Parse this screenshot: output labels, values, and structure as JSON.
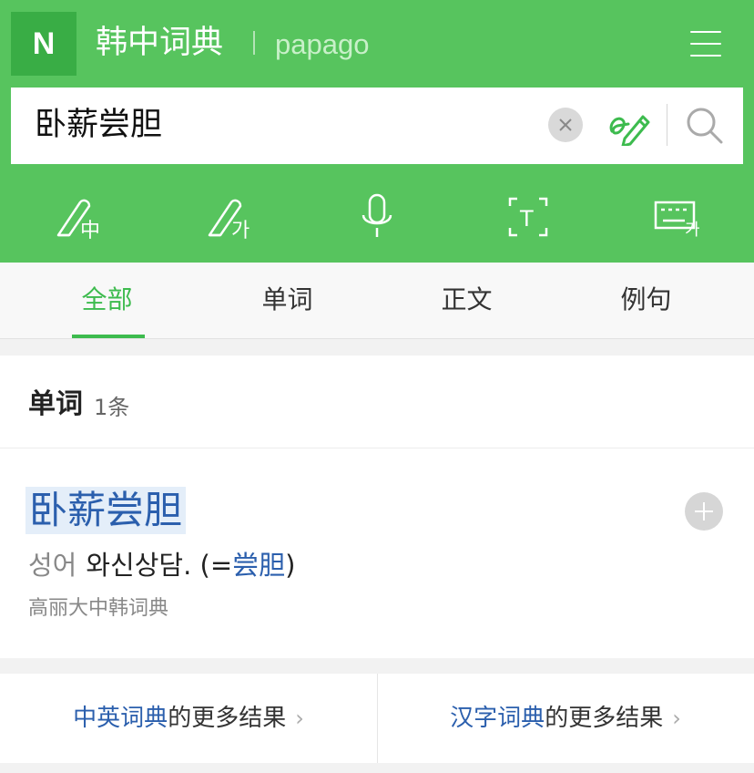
{
  "header": {
    "logo": "N",
    "title": "韩中词典",
    "brand": "papago"
  },
  "search": {
    "query": "卧薪尝胆"
  },
  "icons": {
    "menu": "menu-icon",
    "clear": "clear-icon",
    "handwriting": "handwriting-icon",
    "search": "search-icon",
    "tools": [
      "handwrite-chinese-icon",
      "handwrite-korean-icon",
      "microphone-icon",
      "text-scan-icon",
      "korean-keyboard-icon"
    ]
  },
  "tool_labels": {
    "zh": "中",
    "ko": "가",
    "scan": "T",
    "kbd": "가"
  },
  "tabs": [
    {
      "label": "全部",
      "active": true
    },
    {
      "label": "单词",
      "active": false
    },
    {
      "label": "正文",
      "active": false
    },
    {
      "label": "例句",
      "active": false
    }
  ],
  "results": {
    "section_title": "单词",
    "count": "1条",
    "entry": {
      "word": "卧薪尝胆",
      "pos": "성어",
      "definition": "와신상담. (=",
      "link": "尝胆",
      "definition_end": ")",
      "source": "高丽大中韩词典"
    }
  },
  "more": [
    {
      "dict": "中英词典",
      "suffix": "的更多结果"
    },
    {
      "dict": "汉字词典",
      "suffix": "的更多结果"
    }
  ],
  "colors": {
    "header": "#57c45e",
    "accent": "#3dbb4e",
    "link": "#2b5fad"
  }
}
